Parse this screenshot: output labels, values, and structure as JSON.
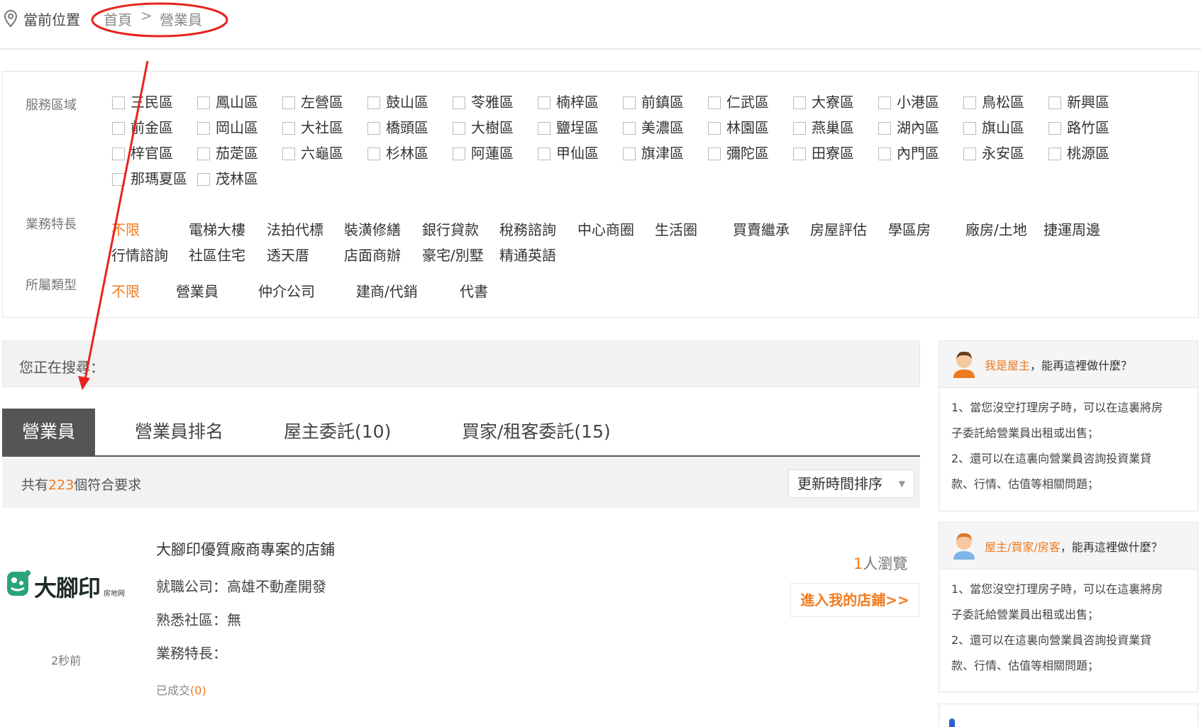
{
  "breadcrumb": {
    "label": "當前位置",
    "home": "首頁",
    "separator": ">",
    "current": "營業員"
  },
  "filters": {
    "district_label": "服務區域",
    "districts": [
      "三民區",
      "鳳山區",
      "左營區",
      "鼓山區",
      "苓雅區",
      "楠梓區",
      "前鎮區",
      "仁武區",
      "大寮區",
      "小港區",
      "鳥松區",
      "新興區",
      "前金區",
      "岡山區",
      "大社區",
      "橋頭區",
      "大樹區",
      "鹽埕區",
      "美濃區",
      "林園區",
      "燕巢區",
      "湖內區",
      "旗山區",
      "路竹區",
      "梓官區",
      "茄萣區",
      "六龜區",
      "杉林區",
      "阿蓮區",
      "甲仙區",
      "旗津區",
      "彌陀區",
      "田寮區",
      "內門區",
      "永安區",
      "桃源區",
      "那瑪夏區",
      "茂林區"
    ],
    "specialty_label": "業務特長",
    "specialties": [
      "不限",
      "電梯大樓",
      "法拍代標",
      "裝潢修繕",
      "銀行貸款",
      "稅務諮詢",
      "中心商圈",
      "生活圈",
      "買賣繼承",
      "房屋評估",
      "學區房",
      "廠房/土地",
      "捷運周邊",
      "行情諮詢",
      "社區住宅",
      "透天厝",
      "店面商辦",
      "豪宅/別墅",
      "精通英語"
    ],
    "type_label": "所屬類型",
    "types": [
      "不限",
      "營業員",
      "仲介公司",
      "建商/代銷",
      "代書"
    ]
  },
  "search": {
    "label": "您正在搜尋："
  },
  "tabs": [
    "營業員",
    "營業員排名",
    "屋主委託(10)",
    "買家/租客委託(15)"
  ],
  "results": {
    "prefix": "共有",
    "count": "223",
    "suffix": "個符合要求",
    "sort_label": "更新時間排序"
  },
  "listing": {
    "logo_text": "大腳印",
    "logo_sub": "房地网",
    "time": "2秒前",
    "title": "大腳印優質廠商專案的店鋪",
    "company": "就職公司：高雄不動產開發",
    "community": "熟悉社區：無",
    "specialty": "業務特長：",
    "deals_label": "已成交",
    "deals_count": "(0)",
    "views_count": "1",
    "views_label": "人瀏覽",
    "store_button": "進入我的店鋪>>"
  },
  "sidebar": {
    "owner": {
      "title_highlight": "我是屋主",
      "title_rest": "，能再這裡做什麼？",
      "lines": [
        "1、當您沒空打理房子時，可以在這裏將房",
        "子委託給營業員出租或出售；",
        "2、還可以在這裏向營業員咨詢投資業貸",
        "款、行情、估值等相關問題；"
      ]
    },
    "buyer": {
      "title_highlight": "屋主/買家/房客",
      "title_rest": "，能再這裡做什麼？",
      "lines": [
        "1、當您沒空打理房子時，可以在這裏將房",
        "子委託給營業員出租或出售；",
        "2、還可以在這裏向營業員咨詢投資業貸",
        "款、行情、估值等相關問題；"
      ]
    }
  },
  "colors": {
    "accent": "#f07a1e",
    "annotation": "#e8231f",
    "tab_active": "#555555"
  }
}
